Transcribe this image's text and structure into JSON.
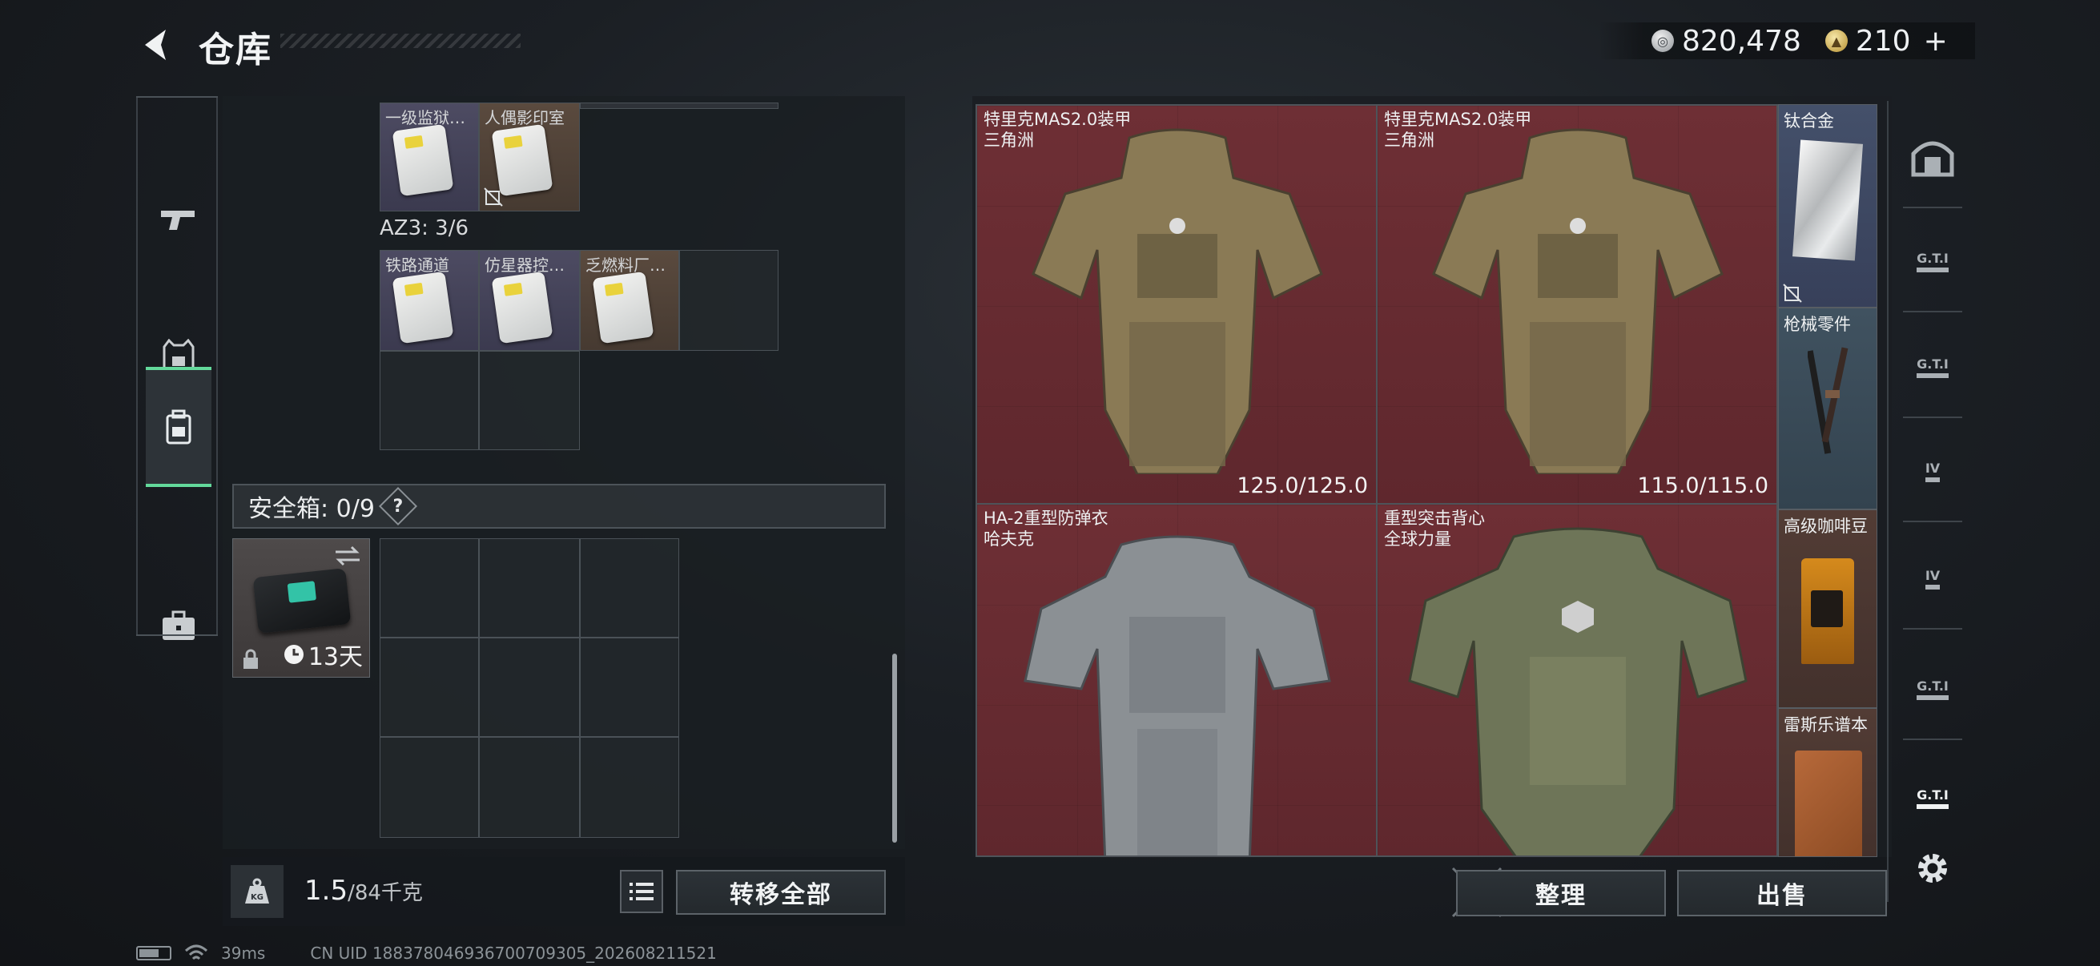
{
  "header": {
    "title": "仓库",
    "silver_amount": "820,478",
    "gold_amount": "210",
    "gold_plus": "+"
  },
  "left_tabs": [
    {
      "name": "weapons",
      "icon": "pistol-icon"
    },
    {
      "name": "armor",
      "icon": "armor-vest-icon"
    },
    {
      "name": "backpack",
      "icon": "backpack-icon",
      "active": true
    },
    {
      "name": "briefcase",
      "icon": "briefcase-icon"
    }
  ],
  "backpack": {
    "top_items": [
      {
        "name": "一级监狱…",
        "bg": "#4d4b62"
      },
      {
        "name": "人偶影印室",
        "bg": "#5a4a3e",
        "unbound": true
      }
    ],
    "az3_label": "AZ3: 3/6",
    "az3_items": [
      {
        "name": "铁路通道"
      },
      {
        "name": "仿星器控…"
      },
      {
        "name": "乏燃料厂…"
      }
    ]
  },
  "safe_box": {
    "label": "安全箱: 0/9",
    "help": "?",
    "days": "13天"
  },
  "weight": {
    "value": "1.5",
    "capacity": "/84千克",
    "kg_icon_text": "KG"
  },
  "buttons": {
    "transfer_all": "转移全部",
    "organize": "整理",
    "sell": "出售"
  },
  "stash": {
    "large_items": [
      {
        "name": "特里克MAS2.0装甲",
        "brand": "三角洲",
        "durability": "125.0/125.0",
        "rarity_color": "#6e2f35"
      },
      {
        "name": "特里克MAS2.0装甲",
        "brand": "三角洲",
        "durability": "115.0/115.0",
        "rarity_color": "#6e2f35"
      },
      {
        "name": "HA-2重型防弹衣",
        "brand": "哈夫克",
        "rarity_color": "#6e2f35"
      },
      {
        "name": "重型突击背心",
        "brand": "全球力量",
        "rarity_color": "#6e2f35"
      }
    ],
    "side_items": [
      {
        "name": "钛合金",
        "bg": "#3f4a5e",
        "unbound": true
      },
      {
        "name": "枪械零件",
        "bg": "#3b4a56"
      },
      {
        "name": "高级咖啡豆",
        "bg": "#4d3a33"
      },
      {
        "name": "雷斯乐谱本",
        "bg": "#4d3a33"
      }
    ]
  },
  "right_tabs": [
    {
      "icon": "safehouse-icon"
    },
    {
      "icon": "gti-rifle-icon",
      "label": "G.T.I"
    },
    {
      "icon": "gti-grenade-icon",
      "label": "G.T.I"
    },
    {
      "icon": "iv-camera-icon",
      "label": "IV"
    },
    {
      "icon": "iv-camera2-icon",
      "label": "IV"
    },
    {
      "icon": "gti-supplies-icon",
      "label": "G.T.I"
    },
    {
      "icon": "gti-gun-settings-icon",
      "label": "G.T.I"
    },
    {
      "icon": "settings-gear-icon"
    }
  ],
  "status": {
    "ping": "39ms",
    "uid": "CN UID 188378046936700709305_202608211521"
  }
}
